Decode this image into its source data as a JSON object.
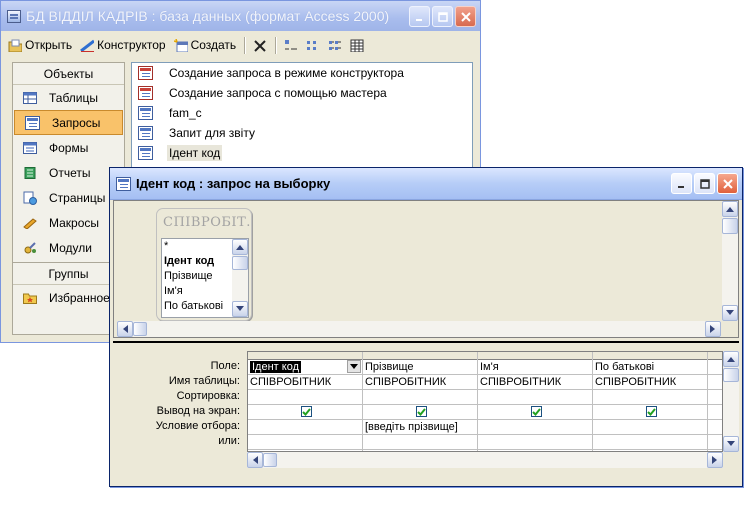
{
  "db_window": {
    "title": "БД ВІДДІЛ КАДРІВ : база данных (формат Access 2000)",
    "toolbar": {
      "open": "Открыть",
      "design": "Конструктор",
      "create": "Создать"
    },
    "nav": {
      "objects_header": "Объекты",
      "items": [
        {
          "label": "Таблицы",
          "icon": "table-icon"
        },
        {
          "label": "Запросы",
          "icon": "query-icon",
          "selected": true
        },
        {
          "label": "Формы",
          "icon": "form-icon"
        },
        {
          "label": "Отчеты",
          "icon": "report-icon"
        },
        {
          "label": "Страницы",
          "icon": "page-icon"
        },
        {
          "label": "Макросы",
          "icon": "macro-icon"
        },
        {
          "label": "Модули",
          "icon": "module-icon"
        }
      ],
      "groups_header": "Группы",
      "favorites": "Избранное"
    },
    "list": [
      "Создание запроса в режиме конструктора",
      "Создание запроса с помощью мастера",
      "fam_c",
      "Запит для звіту",
      "Ідент код"
    ]
  },
  "query_window": {
    "title": "Ідент код : запрос на выборку",
    "table_box": {
      "title": "СПІВРОБІТ...",
      "fields": [
        "*",
        "Ідент код",
        "Прізвище",
        "Ім'я",
        "По батькові"
      ]
    },
    "row_labels": [
      "Поле:",
      "Имя таблицы:",
      "Сортировка:",
      "Вывод на экран:",
      "Условие отбора:",
      "или:"
    ],
    "columns": [
      {
        "field": "Ідент код",
        "table": "СПІВРОБІТНИК",
        "show": true,
        "criteria": ""
      },
      {
        "field": "Прізвище",
        "table": "СПІВРОБІТНИК",
        "show": true,
        "criteria": "[введіть прізвище]"
      },
      {
        "field": "Ім'я",
        "table": "СПІВРОБІТНИК",
        "show": true,
        "criteria": ""
      },
      {
        "field": "По батькові",
        "table": "СПІВРОБІТНИК",
        "show": true,
        "criteria": ""
      }
    ]
  },
  "colors": {
    "selected_nav": "#f9c26a",
    "checkmark": "#21a121",
    "window_face": "#ece9d8"
  }
}
